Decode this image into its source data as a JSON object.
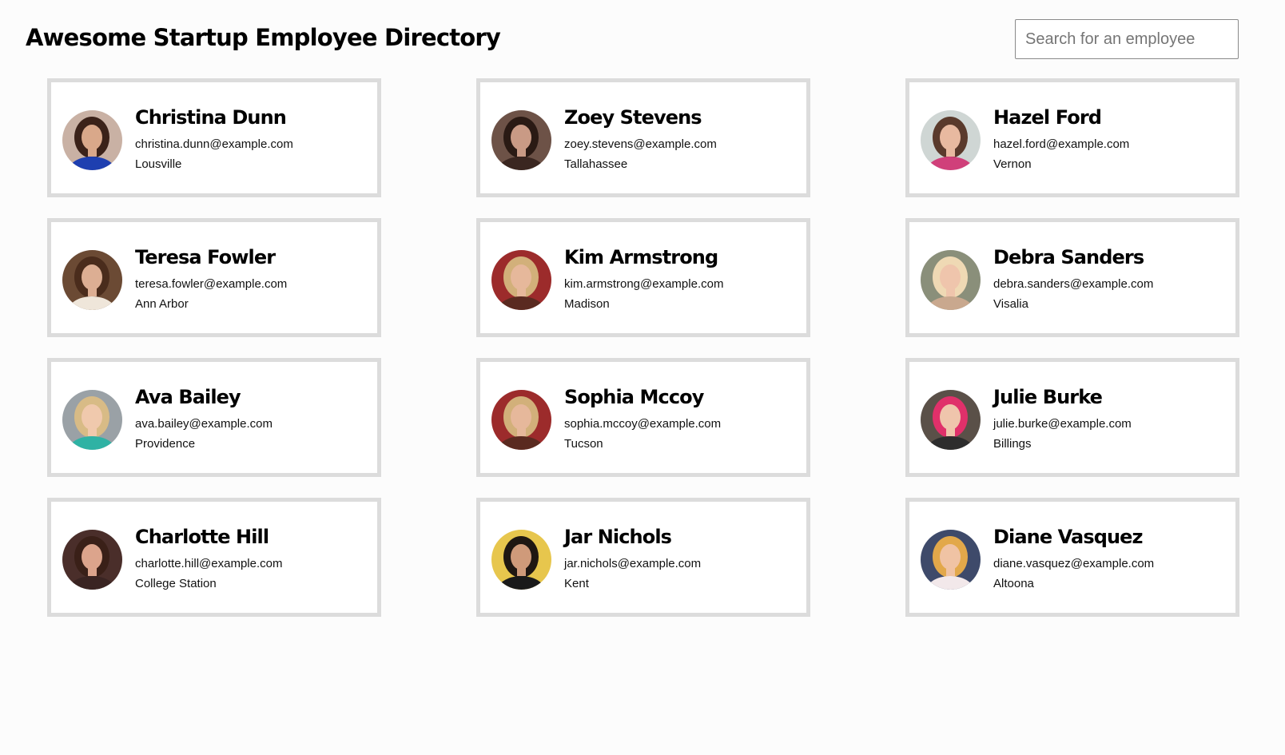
{
  "header": {
    "title": "Awesome Startup Employee Directory",
    "search_placeholder": "Search for an employee",
    "search_value": ""
  },
  "employees": [
    {
      "name": "Christina Dunn",
      "email": "christina.dunn@example.com",
      "city": "Lousville",
      "photo": {
        "bg": "#c9b1a4",
        "hair": "#3b2219",
        "skin": "#d9a88a",
        "shirt": "#1e3fb0"
      }
    },
    {
      "name": "Zoey Stevens",
      "email": "zoey.stevens@example.com",
      "city": "Tallahassee",
      "photo": {
        "bg": "#6d5247",
        "hair": "#2a1a14",
        "skin": "#c99a85",
        "shirt": "#3a2620"
      }
    },
    {
      "name": "Hazel Ford",
      "email": "hazel.ford@example.com",
      "city": "Vernon",
      "photo": {
        "bg": "#cfd6d4",
        "hair": "#5a3a2c",
        "skin": "#e8b9a0",
        "shirt": "#d0407a"
      }
    },
    {
      "name": "Teresa Fowler",
      "email": "teresa.fowler@example.com",
      "city": "Ann Arbor",
      "photo": {
        "bg": "#6b4a34",
        "hair": "#4a2c1c",
        "skin": "#dcae93",
        "shirt": "#efe6da"
      }
    },
    {
      "name": "Kim Armstrong",
      "email": "kim.armstrong@example.com",
      "city": "Madison",
      "photo": {
        "bg": "#9c2b2b",
        "hair": "#d2b07a",
        "skin": "#e6b89b",
        "shirt": "#5a2a20"
      }
    },
    {
      "name": "Debra Sanders",
      "email": "debra.sanders@example.com",
      "city": "Visalia",
      "photo": {
        "bg": "#8a8f7a",
        "hair": "#efd9b4",
        "skin": "#efc5ac",
        "shirt": "#c9a88e"
      }
    },
    {
      "name": "Ava Bailey",
      "email": "ava.bailey@example.com",
      "city": "Providence",
      "photo": {
        "bg": "#9aa1a6",
        "hair": "#d8bb86",
        "skin": "#f0c9ad",
        "shirt": "#2fb2a4"
      }
    },
    {
      "name": "Sophia Mccoy",
      "email": "sophia.mccoy@example.com",
      "city": "Tucson",
      "photo": {
        "bg": "#9c2b2b",
        "hair": "#d2b07a",
        "skin": "#e6b89b",
        "shirt": "#5a2a20"
      }
    },
    {
      "name": "Julie Burke",
      "email": "julie.burke@example.com",
      "city": "Billings",
      "photo": {
        "bg": "#5a5048",
        "hair": "#e0306a",
        "skin": "#efc5ac",
        "shirt": "#2d2d2d"
      }
    },
    {
      "name": "Charlotte Hill",
      "email": "charlotte.hill@example.com",
      "city": "College Station",
      "photo": {
        "bg": "#4a2e2a",
        "hair": "#3a2018",
        "skin": "#dca48c",
        "shirt": "#3a2422"
      }
    },
    {
      "name": "Jar Nichols",
      "email": "jar.nichols@example.com",
      "city": "Kent",
      "photo": {
        "bg": "#e7c64d",
        "hair": "#1f1712",
        "skin": "#cf9a7a",
        "shirt": "#1a1a1a"
      }
    },
    {
      "name": "Diane Vasquez",
      "email": "diane.vasquez@example.com",
      "city": "Altoona",
      "photo": {
        "bg": "#3e4a6a",
        "hair": "#e2a84a",
        "skin": "#f0c3a4",
        "shirt": "#f2e8ea"
      }
    }
  ]
}
